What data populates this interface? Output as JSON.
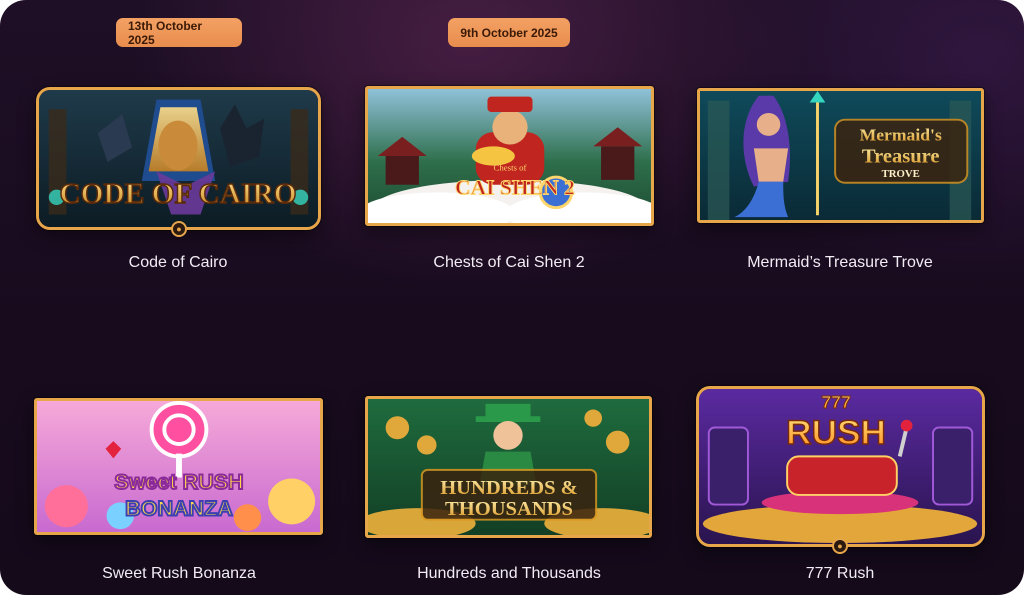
{
  "badges": {
    "cairo_date": "13th October 2025",
    "caishen_date": "9th October 2025"
  },
  "games": [
    {
      "title": "Code of Cairo",
      "logo_line1": "CODE OF CAIRO"
    },
    {
      "title": "Chests of Cai Shen 2",
      "logo_line1": "Chests of",
      "logo_line2": "CAI SHEN 2"
    },
    {
      "title": "Mermaid’s Treasure Trove",
      "logo_line1": "Mermaid's",
      "logo_line2": "Treasure",
      "logo_line3": "TROVE"
    },
    {
      "title": "Sweet Rush Bonanza",
      "logo_line1": "Sweet RUSH",
      "logo_line2": "BONANZA"
    },
    {
      "title": "Hundreds and Thousands",
      "logo_line1": "HUNDREDS &",
      "logo_line2": "THOUSANDS"
    },
    {
      "title": "777 Rush",
      "logo_line1": "777",
      "logo_line2": "RUSH"
    }
  ],
  "colors": {
    "accent_border": "#e8a64a",
    "badge_bg": "#ee965a",
    "background": "#1b0d22"
  },
  "icons": [
    "paw-icon",
    "paw-icon"
  ]
}
